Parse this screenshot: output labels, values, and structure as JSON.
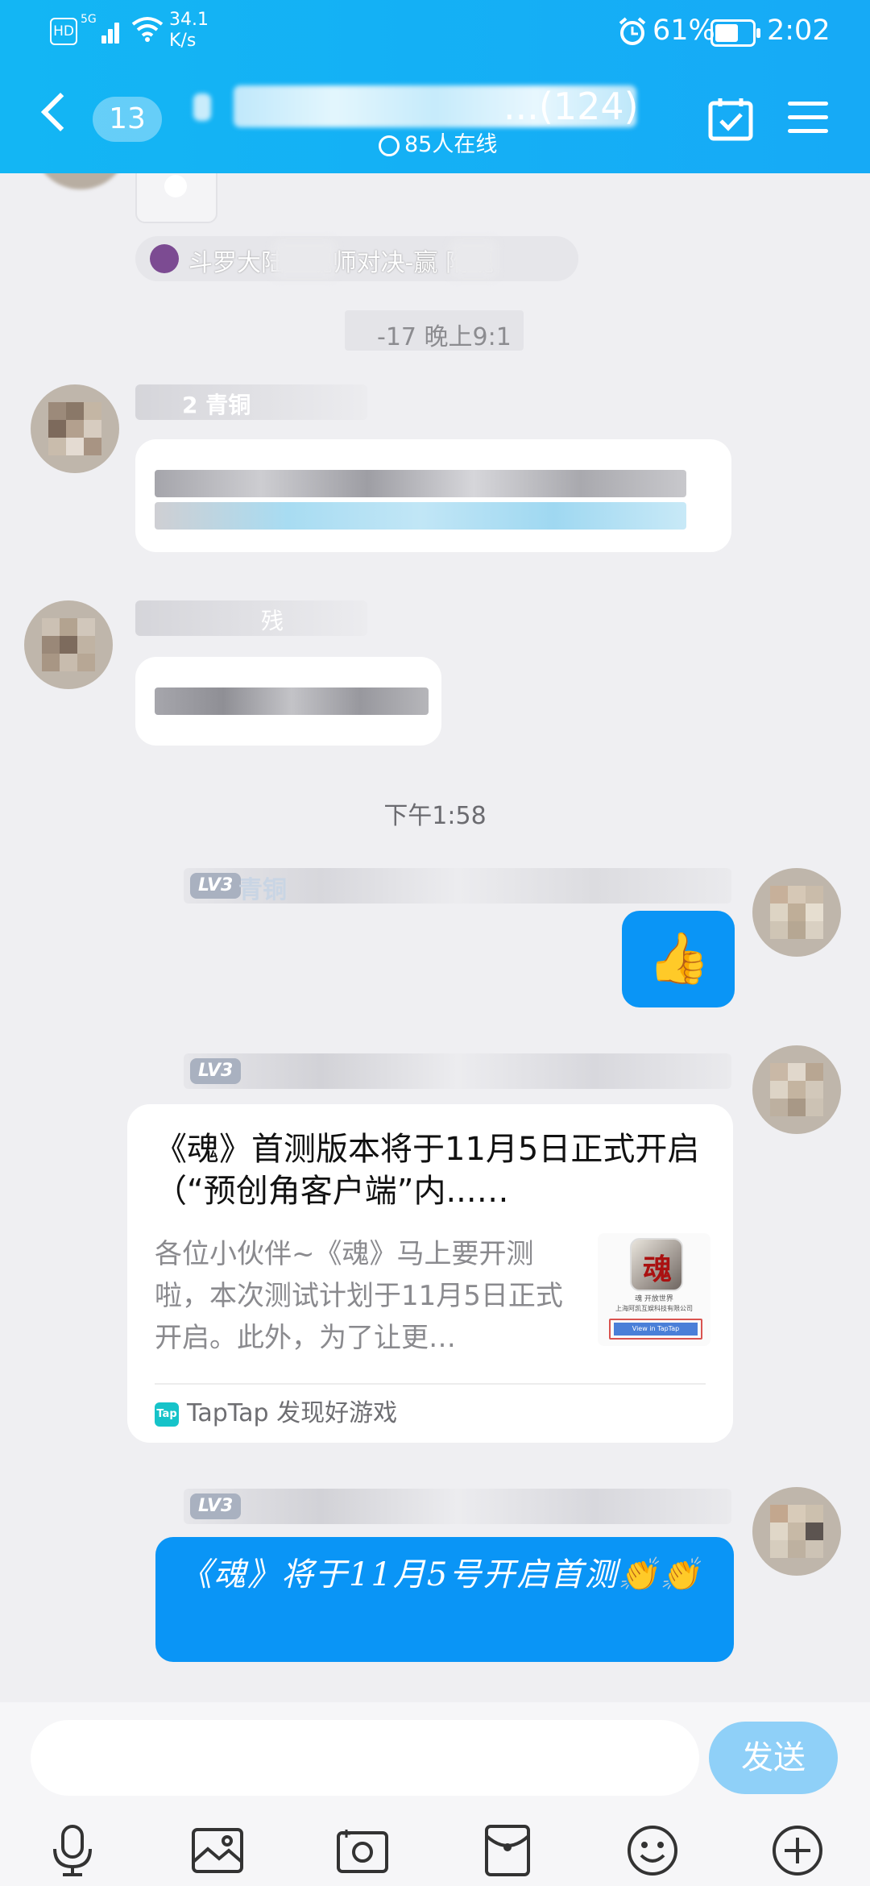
{
  "status_bar": {
    "hd": "HD",
    "net": "5G",
    "speed_value": "34.1",
    "speed_unit": "K/s",
    "battery": "61%",
    "time": "2:02"
  },
  "header": {
    "back_count": "13",
    "group_title_suffix": "...(124)",
    "online_text": "85人在线"
  },
  "chat": {
    "pinned_preview": "斗罗大陆 · 魂师对决-赢 附魂",
    "timestamp_1": "-17 晚上9:1",
    "member_level_1": "2 青铜",
    "member_tag_2": "残",
    "timestamp_2": "下午1:58",
    "level_badge": "LV3",
    "level_name": "青铜",
    "thumb_emoji": "👍",
    "share_card": {
      "title": "《魂》首测版本将于11月5日正式开启（“预创角客户端”内...…",
      "description": "各位小伙伴~《魂》马上要开测啦，本次测试计划于11月5日正式开启。此外，为了让更…",
      "source": "TapTap 发现好游戏",
      "logo_text": "Tap",
      "thumb_caption": "魂 开放世界",
      "thumb_company": "上海阿凯互娱科技有限公司",
      "thumb_button": "View in TapTap"
    },
    "last_message": "《魂》将于11月5号开启首测👏👏"
  },
  "input": {
    "placeholder": "",
    "send_label": "发送"
  },
  "toolbar": [
    "microphone-icon",
    "image-icon",
    "camera-icon",
    "red-packet-icon",
    "emoji-icon",
    "plus-icon"
  ]
}
